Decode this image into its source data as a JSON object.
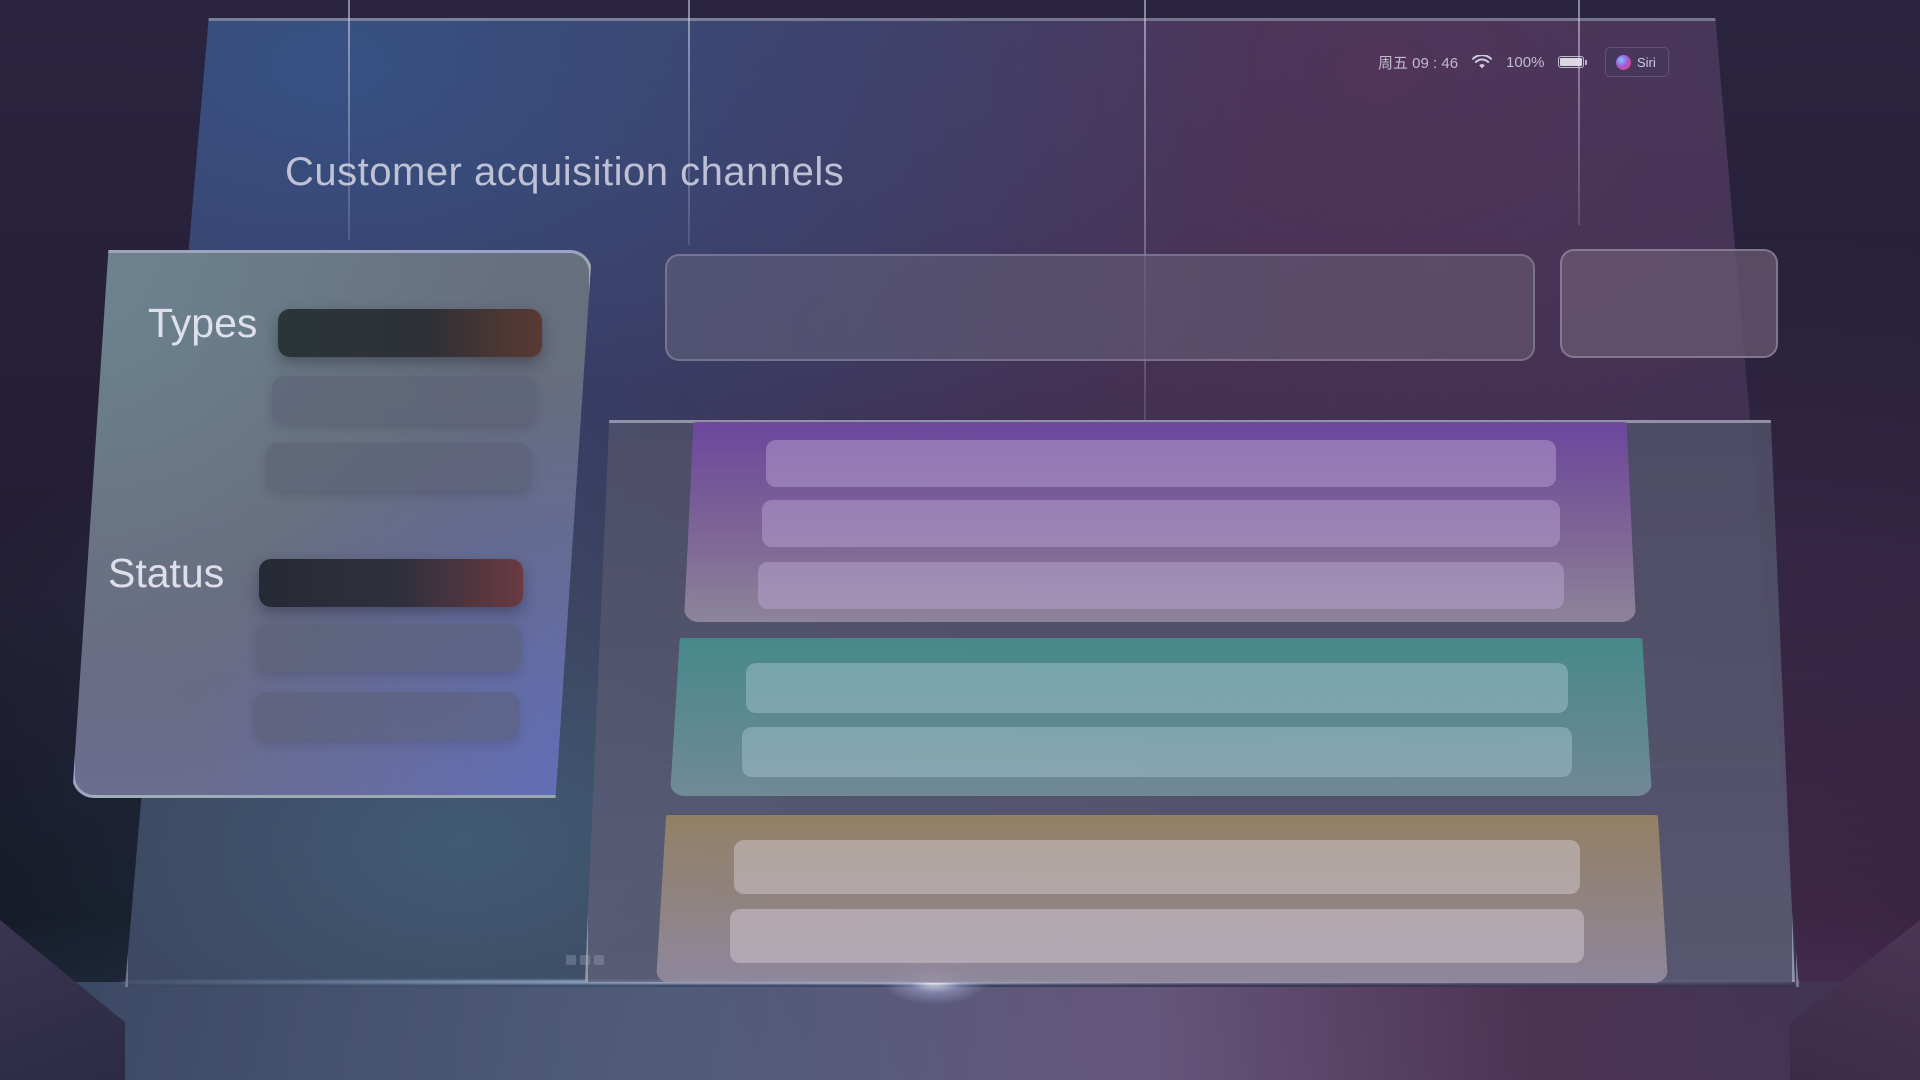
{
  "status_bar": {
    "datetime": "周五 09 : 46",
    "battery_percent": "100%",
    "wifi_icon": "wifi-icon",
    "battery_icon": "battery-full-icon",
    "siri_label": "Siri",
    "siri_icon": "siri-orb-icon"
  },
  "page": {
    "title": "Customer acquisition channels"
  },
  "filters": {
    "types": {
      "label": "Types",
      "options": 3,
      "selected_index": 0
    },
    "status": {
      "label": "Status",
      "options": 3,
      "selected_index": 0
    }
  },
  "content": {
    "groups": [
      {
        "color": "purple",
        "rows": 3
      },
      {
        "color": "teal",
        "rows": 2
      },
      {
        "color": "amber",
        "rows": 2
      }
    ]
  },
  "pagination": {
    "dots": 3
  },
  "colors": {
    "accent_purple": "#6e46a0",
    "accent_teal": "#468c8c",
    "accent_amber": "#968264",
    "selected_chip_warm": "#5a3a33",
    "selected_chip_red": "#6a3a42"
  }
}
